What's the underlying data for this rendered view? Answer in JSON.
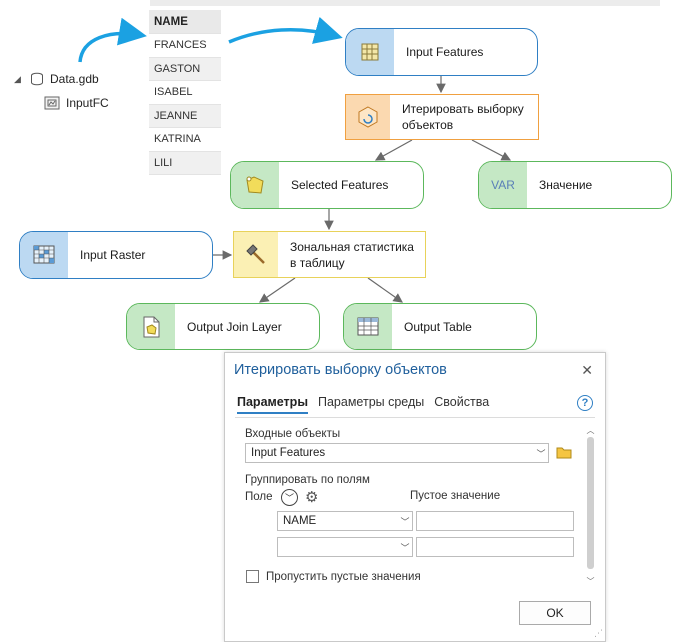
{
  "catalog": {
    "gdb": "Data.gdb",
    "feature_class": "InputFC"
  },
  "attribute_table": {
    "header": "NAME",
    "rows": [
      "FRANCES",
      "GASTON",
      "ISABEL",
      "JEANNE",
      "KATRINA",
      "LILI"
    ]
  },
  "model": {
    "input_features": "Input Features",
    "iterate_tool": "Итерировать выборку объектов",
    "selected_features": "Selected Features",
    "value_var": "Значение",
    "var_icon_text": "VAR",
    "input_raster": "Input Raster",
    "zonal_tool": "Зональная статистика в таблицу",
    "output_join_layer": "Output Join Layer",
    "output_table": "Output Table"
  },
  "dialog": {
    "title": "Итерировать выборку объектов",
    "close": "✕",
    "tabs": [
      "Параметры",
      "Параметры среды",
      "Свойства"
    ],
    "help": "?",
    "input_label": "Входные объекты",
    "input_value": "Input Features",
    "group_label": "Группировать по полям",
    "field_col": "Поле",
    "null_col": "Пустое значение",
    "field_row1": "NAME",
    "field_row2": "",
    "skip_nulls": "Пропустить пустые значения",
    "ok": "OK"
  },
  "colors": {
    "data_blue": "#2f7fc4",
    "data_green": "#5cb85c",
    "tool_orange": "#f0a040",
    "tool_yellow": "#e8d25a",
    "arrow_cyan": "#1ba1e2"
  }
}
